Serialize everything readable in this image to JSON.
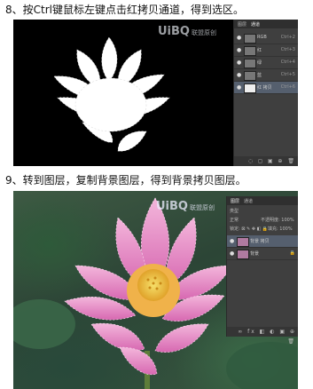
{
  "steps": {
    "step8": "8、按Ctrl键鼠标左键点击红拷贝通道，得到选区。",
    "step9": "9、转到图层，复制背景图层，得到背景拷贝图层。"
  },
  "figure1": {
    "watermark": {
      "logo": "UiBQ",
      "text": "联盟原创"
    },
    "panel": {
      "tabs": [
        "图层",
        "通道"
      ],
      "rows": [
        {
          "name": "RGB",
          "key": "Ctrl+2"
        },
        {
          "name": "红",
          "key": "Ctrl+3"
        },
        {
          "name": "绿",
          "key": "Ctrl+4"
        },
        {
          "name": "蓝",
          "key": "Ctrl+5"
        },
        {
          "name": "红 拷贝",
          "key": "Ctrl+6"
        }
      ],
      "footer_icons": "◌ ◻ ▣ ⊕ 🗑"
    }
  },
  "figure2": {
    "watermark": {
      "logo": "UiBQ",
      "text": "联盟原创"
    },
    "panel": {
      "tabs": [
        "图层",
        "通道"
      ],
      "kind_label": "类型",
      "blend_mode": "正常",
      "opacity_label": "不透明度: 100%",
      "lock_label": "锁定: ⊠ ✎ ✥ ◧ 🔒",
      "fill_label": "填充: 100%",
      "rows": [
        {
          "name": "背景 拷贝"
        },
        {
          "name": "背景",
          "lock": "🔒"
        }
      ],
      "footer_icons": "∞ fx ◧ ◐ ▣ ⊕ 🗑"
    }
  },
  "colors": {
    "panel_bg": "#3f3f3f",
    "selected_row": "#555f6e",
    "petal_pink": "#e58cc6",
    "seedpod": "#f2d34a"
  }
}
